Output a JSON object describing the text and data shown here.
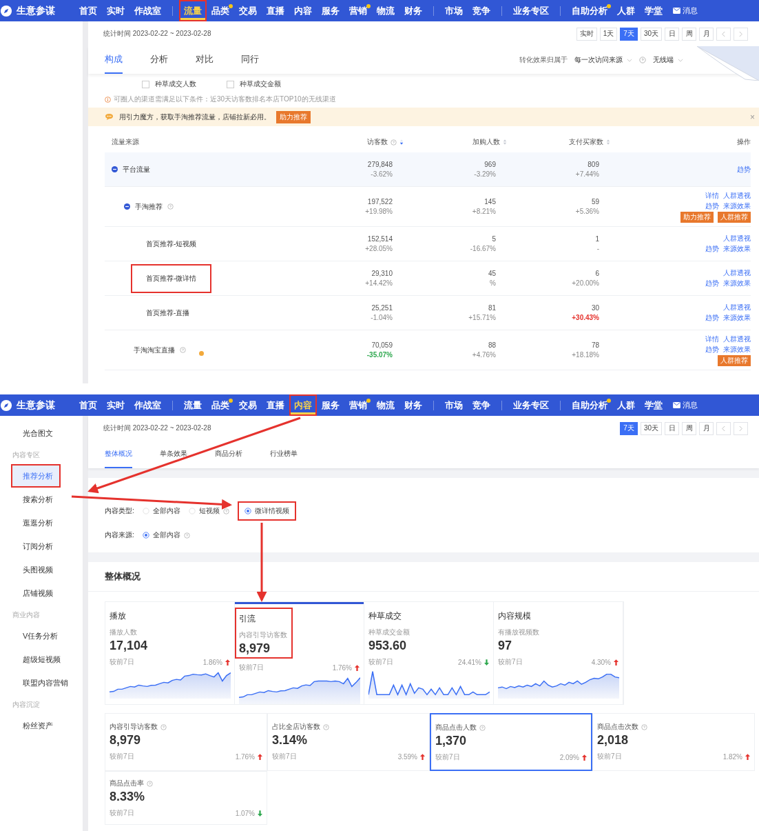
{
  "traffic_screen": {
    "nav": {
      "logo": "生意参谋",
      "message": "消息",
      "items": [
        {
          "label": "首页",
          "selected": false
        },
        {
          "label": "实时",
          "selected": false
        },
        {
          "label": "作战室",
          "selected": false
        },
        {
          "label": "流量",
          "selected": true,
          "divider_before": true,
          "annotated": true
        },
        {
          "label": "品类",
          "selected": false,
          "dot": true
        },
        {
          "label": "交易",
          "selected": false
        },
        {
          "label": "直播",
          "selected": false
        },
        {
          "label": "内容",
          "selected": false
        },
        {
          "label": "服务",
          "selected": false
        },
        {
          "label": "营销",
          "selected": false,
          "dot": true
        },
        {
          "label": "物流",
          "selected": false
        },
        {
          "label": "财务",
          "selected": false
        },
        {
          "label": "市场",
          "selected": false,
          "divider_before": true
        },
        {
          "label": "竞争",
          "selected": false
        },
        {
          "label": "业务专区",
          "selected": false,
          "divider_before": true
        },
        {
          "label": "自助分析",
          "selected": false,
          "divider_before": true,
          "dot": true
        },
        {
          "label": "人群",
          "selected": false
        },
        {
          "label": "学堂",
          "selected": false
        }
      ]
    },
    "date_range": "统计时间 2023-02-22 ~ 2023-02-28",
    "period_buttons": [
      {
        "kind": "label",
        "label": "实时",
        "selected": false
      },
      {
        "kind": "label",
        "label": "1天",
        "selected": false
      },
      {
        "kind": "label",
        "label": "7天",
        "selected": true
      },
      {
        "kind": "label",
        "label": "30天",
        "selected": false
      },
      {
        "kind": "label",
        "label": "日",
        "selected": false
      },
      {
        "kind": "label",
        "label": "周",
        "selected": false
      },
      {
        "kind": "label",
        "label": "月",
        "selected": false
      },
      {
        "kind": "prev",
        "selected": false
      },
      {
        "kind": "next",
        "selected": false
      }
    ],
    "tabs": [
      {
        "label": "构成",
        "selected": true
      },
      {
        "label": "分析",
        "selected": false
      },
      {
        "label": "对比",
        "selected": false
      },
      {
        "label": "同行",
        "selected": false
      }
    ],
    "attribution": {
      "label": "转化效果归属于",
      "value": "每一次访问来源",
      "device": "无线端"
    },
    "metric_checkboxes": [
      {
        "label": "种草成交人数",
        "checked": false
      },
      {
        "label": "种草成交金额",
        "checked": false
      }
    ],
    "notice": "可圈人的渠道需满足以下条件：近30天访客数排名本店TOP10的无线渠道",
    "banner": {
      "text": "用引力魔方，获取手淘推荐流量，店铺拉新必用。",
      "button": "助力推荐",
      "close": "×"
    },
    "table": {
      "columns": [
        {
          "label": "流量来源"
        },
        {
          "label": "访客数",
          "sortable": true,
          "sorted": true,
          "help": true
        },
        {
          "label": "加购人数",
          "sortable": true,
          "sorted": false
        },
        {
          "label": "支付买家数",
          "sortable": true,
          "sorted": false
        },
        {
          "label": "操作"
        }
      ],
      "rows": [
        {
          "source": "平台流量",
          "expanded": true,
          "highlighted": true,
          "visitors": {
            "value": "279,848",
            "change": "-3.62%"
          },
          "add_cart": {
            "value": "969",
            "change": "-3.29%"
          },
          "buyers": {
            "value": "809",
            "change": "+7.44%"
          },
          "actions": [
            [
              {
                "text": "趋势",
                "kind": "link"
              }
            ]
          ],
          "children": [
            {
              "source": "手淘推荐",
              "help": true,
              "expanded": true,
              "visitors": {
                "value": "197,522",
                "change": "+19.98%"
              },
              "add_cart": {
                "value": "145",
                "change": "+8.21%"
              },
              "buyers": {
                "value": "59",
                "change": "+5.36%"
              },
              "actions": [
                [
                  {
                    "text": "详情",
                    "kind": "link"
                  },
                  {
                    "text": "人群透视",
                    "kind": "link"
                  }
                ],
                [
                  {
                    "text": "趋势",
                    "kind": "link"
                  },
                  {
                    "text": "来源效果",
                    "kind": "link"
                  }
                ],
                [
                  {
                    "text": "助力推荐",
                    "kind": "badge"
                  },
                  {
                    "text": "人群推荐",
                    "kind": "badge"
                  }
                ]
              ],
              "children": [
                {
                  "source": "首页推荐-短视频",
                  "visitors": {
                    "value": "152,514",
                    "change": "+28.05%"
                  },
                  "add_cart": {
                    "value": "5",
                    "change": "-16.67%"
                  },
                  "buyers": {
                    "value": "1",
                    "change": "-"
                  },
                  "actions": [
                    [
                      {
                        "text": "人群透视",
                        "kind": "link"
                      }
                    ],
                    [
                      {
                        "text": "趋势",
                        "kind": "link"
                      },
                      {
                        "text": "来源效果",
                        "kind": "link"
                      }
                    ]
                  ]
                },
                {
                  "source": "首页推荐-微详情",
                  "annotated": true,
                  "visitors": {
                    "value": "29,310",
                    "change": "+14.42%"
                  },
                  "add_cart": {
                    "value": "45",
                    "change": "%"
                  },
                  "buyers": {
                    "value": "6",
                    "change": "+20.00%"
                  },
                  "actions": [
                    [
                      {
                        "text": "人群透视",
                        "kind": "link"
                      }
                    ],
                    [
                      {
                        "text": "趋势",
                        "kind": "link"
                      },
                      {
                        "text": "来源效果",
                        "kind": "link"
                      }
                    ]
                  ]
                },
                {
                  "source": "首页推荐-直播",
                  "visitors": {
                    "value": "25,251",
                    "change": "-1.04%"
                  },
                  "add_cart": {
                    "value": "81",
                    "change": "+15.71%"
                  },
                  "buyers": {
                    "value": "30",
                    "change": "+30.43%",
                    "color": "#e5322d"
                  },
                  "actions": [
                    [
                      {
                        "text": "人群透视",
                        "kind": "link"
                      }
                    ],
                    [
                      {
                        "text": "趋势",
                        "kind": "link"
                      },
                      {
                        "text": "来源效果",
                        "kind": "link"
                      }
                    ]
                  ]
                }
              ]
            },
            {
              "source": "手淘淘宝直播",
              "help": true,
              "dot": true,
              "visitors": {
                "value": "70,059",
                "change": "-35.07%",
                "color": "#2fa84f"
              },
              "add_cart": {
                "value": "88",
                "change": "+4.76%"
              },
              "buyers": {
                "value": "78",
                "change": "+18.18%"
              },
              "actions": [
                [
                  {
                    "text": "详情",
                    "kind": "link"
                  },
                  {
                    "text": "人群透视",
                    "kind": "link"
                  }
                ],
                [
                  {
                    "text": "趋势",
                    "kind": "link"
                  },
                  {
                    "text": "来源效果",
                    "kind": "link"
                  }
                ],
                [
                  {
                    "text": "人群推荐",
                    "kind": "badge"
                  }
                ]
              ]
            }
          ]
        }
      ]
    }
  },
  "content_screen": {
    "nav": {
      "logo": "生意参谋",
      "message": "消息",
      "items": [
        {
          "label": "首页",
          "selected": false
        },
        {
          "label": "实时",
          "selected": false
        },
        {
          "label": "作战室",
          "selected": false
        },
        {
          "label": "流量",
          "selected": false,
          "divider_before": true
        },
        {
          "label": "品类",
          "selected": false,
          "dot": true
        },
        {
          "label": "交易",
          "selected": false
        },
        {
          "label": "直播",
          "selected": false
        },
        {
          "label": "内容",
          "selected": true,
          "annotated": true
        },
        {
          "label": "服务",
          "selected": false
        },
        {
          "label": "营销",
          "selected": false,
          "dot": true
        },
        {
          "label": "物流",
          "selected": false
        },
        {
          "label": "财务",
          "selected": false
        },
        {
          "label": "市场",
          "selected": false,
          "divider_before": true
        },
        {
          "label": "竞争",
          "selected": false
        },
        {
          "label": "业务专区",
          "selected": false,
          "divider_before": true
        },
        {
          "label": "自助分析",
          "selected": false,
          "divider_before": true,
          "dot": true
        },
        {
          "label": "人群",
          "selected": false
        },
        {
          "label": "学堂",
          "selected": false
        }
      ]
    },
    "sidebar": [
      {
        "kind": "item",
        "label": "光合图文",
        "selected": false
      },
      {
        "kind": "section",
        "label": "内容专区"
      },
      {
        "kind": "item",
        "label": "推荐分析",
        "selected": true,
        "annotated": true
      },
      {
        "kind": "item",
        "label": "搜索分析",
        "selected": false
      },
      {
        "kind": "item",
        "label": "逛逛分析",
        "selected": false
      },
      {
        "kind": "item",
        "label": "订阅分析",
        "selected": false
      },
      {
        "kind": "item",
        "label": "头图视频",
        "selected": false
      },
      {
        "kind": "item",
        "label": "店铺视频",
        "selected": false
      },
      {
        "kind": "section",
        "label": "商业内容"
      },
      {
        "kind": "item",
        "label": "V任务分析",
        "selected": false
      },
      {
        "kind": "item",
        "label": "超级短视频",
        "selected": false
      },
      {
        "kind": "item",
        "label": "联盟内容营销",
        "selected": false
      },
      {
        "kind": "section",
        "label": "内容沉淀"
      },
      {
        "kind": "item",
        "label": "粉丝资产",
        "selected": false
      }
    ],
    "date_range": "统计时间 2023-02-22 ~ 2023-02-28",
    "period_buttons": [
      {
        "kind": "label",
        "label": "7天",
        "selected": true
      },
      {
        "kind": "label",
        "label": "30天",
        "selected": false
      },
      {
        "kind": "label",
        "label": "日",
        "selected": false
      },
      {
        "kind": "label",
        "label": "周",
        "selected": false
      },
      {
        "kind": "label",
        "label": "月",
        "selected": false
      },
      {
        "kind": "prev",
        "selected": false
      },
      {
        "kind": "next",
        "selected": false
      }
    ],
    "tabs": [
      {
        "label": "整体概况",
        "selected": true
      },
      {
        "label": "单条效果",
        "selected": false
      },
      {
        "label": "商品分析",
        "selected": false
      },
      {
        "label": "行业榜单",
        "selected": false
      }
    ],
    "filters": [
      {
        "label": "内容类型:",
        "options": [
          {
            "label": "全部内容",
            "selected": false
          },
          {
            "label": "短视频",
            "help": true,
            "selected": false
          },
          {
            "label": "微详情视频",
            "selected": true,
            "annotated": true
          }
        ]
      },
      {
        "label": "内容来源:",
        "options": [
          {
            "label": "全部内容",
            "help": true,
            "selected": true
          }
        ]
      }
    ],
    "overview": {
      "title": "整体概况",
      "cards": [
        {
          "title": "播放",
          "metric": "播放人数",
          "value": "17,104",
          "compare": "较前7日",
          "change": "1.86%",
          "up": true,
          "selected": false
        },
        {
          "title": "引流",
          "metric": "内容引导访客数",
          "value": "8,979",
          "compare": "较前7日",
          "change": "1.76%",
          "up": true,
          "selected": true,
          "annotated": true
        },
        {
          "title": "种草成交",
          "metric": "种草成交金额",
          "value": "953.60",
          "compare": "较前7日",
          "change": "24.41%",
          "up": false,
          "selected": false
        },
        {
          "title": "内容规模",
          "metric": "有播放视频数",
          "value": "97",
          "compare": "较前7日",
          "change": "4.30%",
          "up": true,
          "selected": false
        }
      ],
      "details": [
        {
          "label": "内容引导访客数",
          "value": "8,979",
          "compare": "较前7日",
          "change": "1.76%",
          "up": true,
          "selected": false
        },
        {
          "label": "占比全店访客数",
          "value": "3.14%",
          "compare": "较前7日",
          "change": "3.59%",
          "up": true,
          "selected": false
        },
        {
          "label": "商品点击人数",
          "value": "1,370",
          "compare": "较前7日",
          "change": "2.09%",
          "up": true,
          "selected": true
        },
        {
          "label": "商品点击次数",
          "value": "2,018",
          "compare": "较前7日",
          "change": "1.82%",
          "up": true,
          "selected": false
        },
        {
          "label": "商品点击率",
          "value": "8.33%",
          "compare": "较前7日",
          "change": "1.07%",
          "up": false,
          "selected": false
        }
      ]
    }
  }
}
